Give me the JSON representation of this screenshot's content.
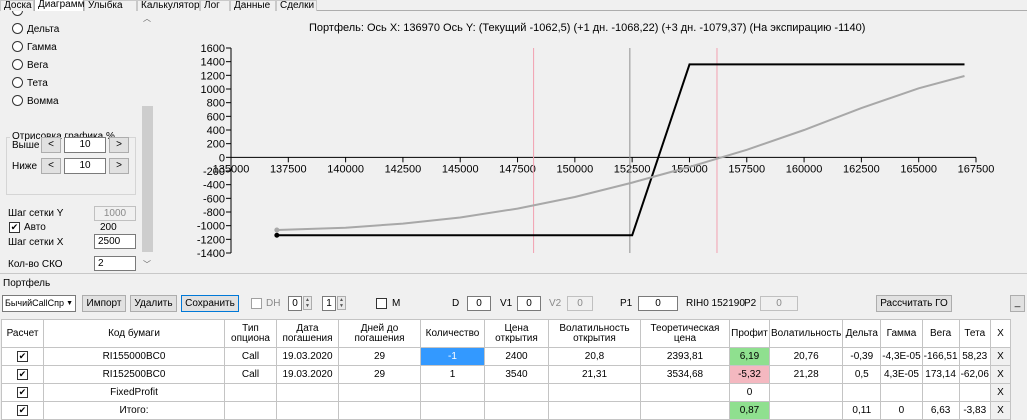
{
  "tabs": [
    "Доска",
    "Диаграмма",
    "Улыбка",
    "Калькулятор",
    "Лог",
    "Данные",
    "Сделки"
  ],
  "active_tab": 1,
  "left": {
    "radios": [
      "Дельта",
      "Гамма",
      "Вега",
      "Тета",
      "Вомма"
    ],
    "otrisovka_title": "Отрисовка графика %",
    "vyshe_label": "Выше",
    "vyshe_value": "10",
    "nizhe_label": "Ниже",
    "nizhe_value": "10",
    "dec": "<",
    "inc": ">",
    "grid_y_label": "Шаг сетки Y",
    "grid_y_value": "1000",
    "auto_label": "Авто",
    "auto_checked": "✔",
    "auto_value": "200",
    "grid_x_label": "Шаг сетки X",
    "grid_x_value": "2500",
    "sko_label": "Кол-во СКО",
    "sko_value": "2",
    "chevron_up": "︿",
    "chevron_down": "﹀"
  },
  "chart_header": {
    "text": "Портфель: Ось X: 136970 Ось Y:  (Текущий -1062,5)  (+1 дн. -1068,22)  (+3 дн. -1079,37)  (На экспирацию -1140)"
  },
  "chart_data": {
    "type": "line",
    "xlim": [
      135000,
      167500
    ],
    "ylim": [
      -1400,
      1600
    ],
    "x_ticks": [
      "135000",
      "137500",
      "140000",
      "142500",
      "145000",
      "147500",
      "150000",
      "152500",
      "155000",
      "157500",
      "160000",
      "162500",
      "165000",
      "167500"
    ],
    "y_ticks": [
      "1600",
      "1400",
      "1200",
      "1000",
      "800",
      "600",
      "400",
      "200",
      "0",
      "-200",
      "-400",
      "-600",
      "-800",
      "-1000",
      "-1200",
      "-1400"
    ],
    "vlines": [
      {
        "x": 148200,
        "color": "#f2a0b0"
      },
      {
        "x": 152400,
        "color": "#909090"
      },
      {
        "x": 156200,
        "color": "#f2a0b0"
      }
    ],
    "series": [
      {
        "color": "#000000",
        "x": [
          137000,
          152500,
          155000,
          167000
        ],
        "y": [
          -1140,
          -1140,
          1360,
          1360
        ]
      },
      {
        "color": "#a8a8a8",
        "x": [
          137000,
          140000,
          142500,
          145000,
          147500,
          150000,
          152500,
          155000,
          157500,
          160000,
          162500,
          165000,
          167000
        ],
        "y": [
          -1063,
          -1030,
          -970,
          -880,
          -750,
          -580,
          -370,
          -140,
          110,
          400,
          720,
          1010,
          1190
        ]
      }
    ]
  },
  "portfolio": {
    "group_label": "Портфель",
    "selector": "БычийCallСпр",
    "import_btn": "Импорт",
    "delete_btn": "Удалить",
    "save_btn": "Сохранить",
    "dh_label": "DH",
    "spin1": "0",
    "spin2": "1",
    "m_label": "M",
    "d_label": "D",
    "d_value": "0",
    "v1_label": "V1",
    "v1_value": "0",
    "v2_label": "V2",
    "v2_value": "0",
    "p1_label": "P1",
    "p1_value": "0",
    "rih": "RIH0 152190",
    "p2_label": "P2",
    "p2_value": "0",
    "calc_btn": "Рассчитать ГО",
    "min_btn": "_"
  },
  "table": {
    "headers": [
      "Расчет",
      "Код бумаги",
      "Тип опциона",
      "Дата погашения",
      "Дней до погашения",
      "Количество",
      "Цена открытия",
      "Волатильность открытия",
      "Теоретическая цена",
      "Профит",
      "Волатильность",
      "Дельта",
      "Гамма",
      "Вега",
      "Тета",
      "X"
    ],
    "rows": [
      [
        "✔",
        "RI155000BC0",
        "Call",
        "19.03.2020",
        "29",
        "-1",
        "2400",
        "20,8",
        "2393,81",
        "6,19",
        "20,76",
        "-0,39",
        "-4,3E-05",
        "-166,51",
        "58,23",
        "X"
      ],
      [
        "✔",
        "RI152500BC0",
        "Call",
        "19.03.2020",
        "29",
        "1",
        "3540",
        "21,31",
        "3534,68",
        "-5,32",
        "21,28",
        "0,5",
        "4,3E-05",
        "173,14",
        "-62,06",
        "X"
      ],
      [
        "✔",
        "FixedProfit",
        "",
        "",
        "",
        "",
        "",
        "",
        "",
        "0",
        "",
        "",
        "",
        "",
        "",
        "X"
      ],
      [
        "✔",
        "Итого:",
        "",
        "",
        "",
        "",
        "",
        "",
        "",
        "0,87",
        "",
        "0,11",
        "0",
        "6,63",
        "-3,83",
        "X"
      ]
    ]
  }
}
